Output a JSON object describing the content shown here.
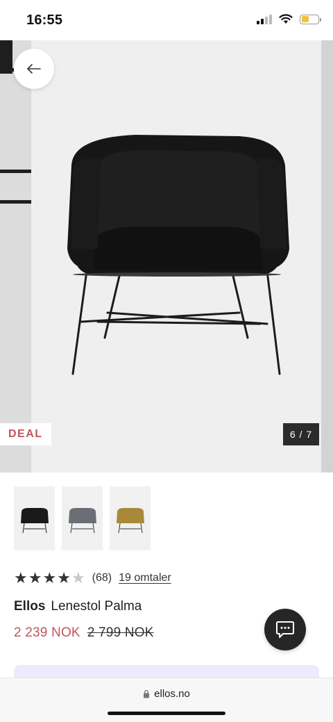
{
  "status_bar": {
    "time": "16:55",
    "icons": [
      "cellular-signal-icon",
      "wifi-icon",
      "battery-icon"
    ],
    "battery_level": 0.45,
    "battery_color": "#f2c230"
  },
  "gallery": {
    "back_icon": "arrow-left-icon",
    "badge": "DEAL",
    "counter": "6 / 7"
  },
  "thumbnails": [
    {
      "alt": "black chair",
      "color": "#1a1a1a"
    },
    {
      "alt": "grey chair",
      "color": "#6b6e74"
    },
    {
      "alt": "ochre chair",
      "color": "#a8893a"
    }
  ],
  "rating": {
    "stars": 4,
    "max_stars": 5,
    "count": "(68)",
    "reviews_link": "19 omtaler"
  },
  "product": {
    "brand": "Ellos",
    "name": "Lenestol Palma",
    "price_now": "2 239 NOK",
    "price_old": "2 799 NOK",
    "price_color": "#c0555b"
  },
  "chat": {
    "icon": "chat-bubble-icon"
  },
  "browser": {
    "lock_icon": "lock-icon",
    "url": "ellos.no"
  }
}
